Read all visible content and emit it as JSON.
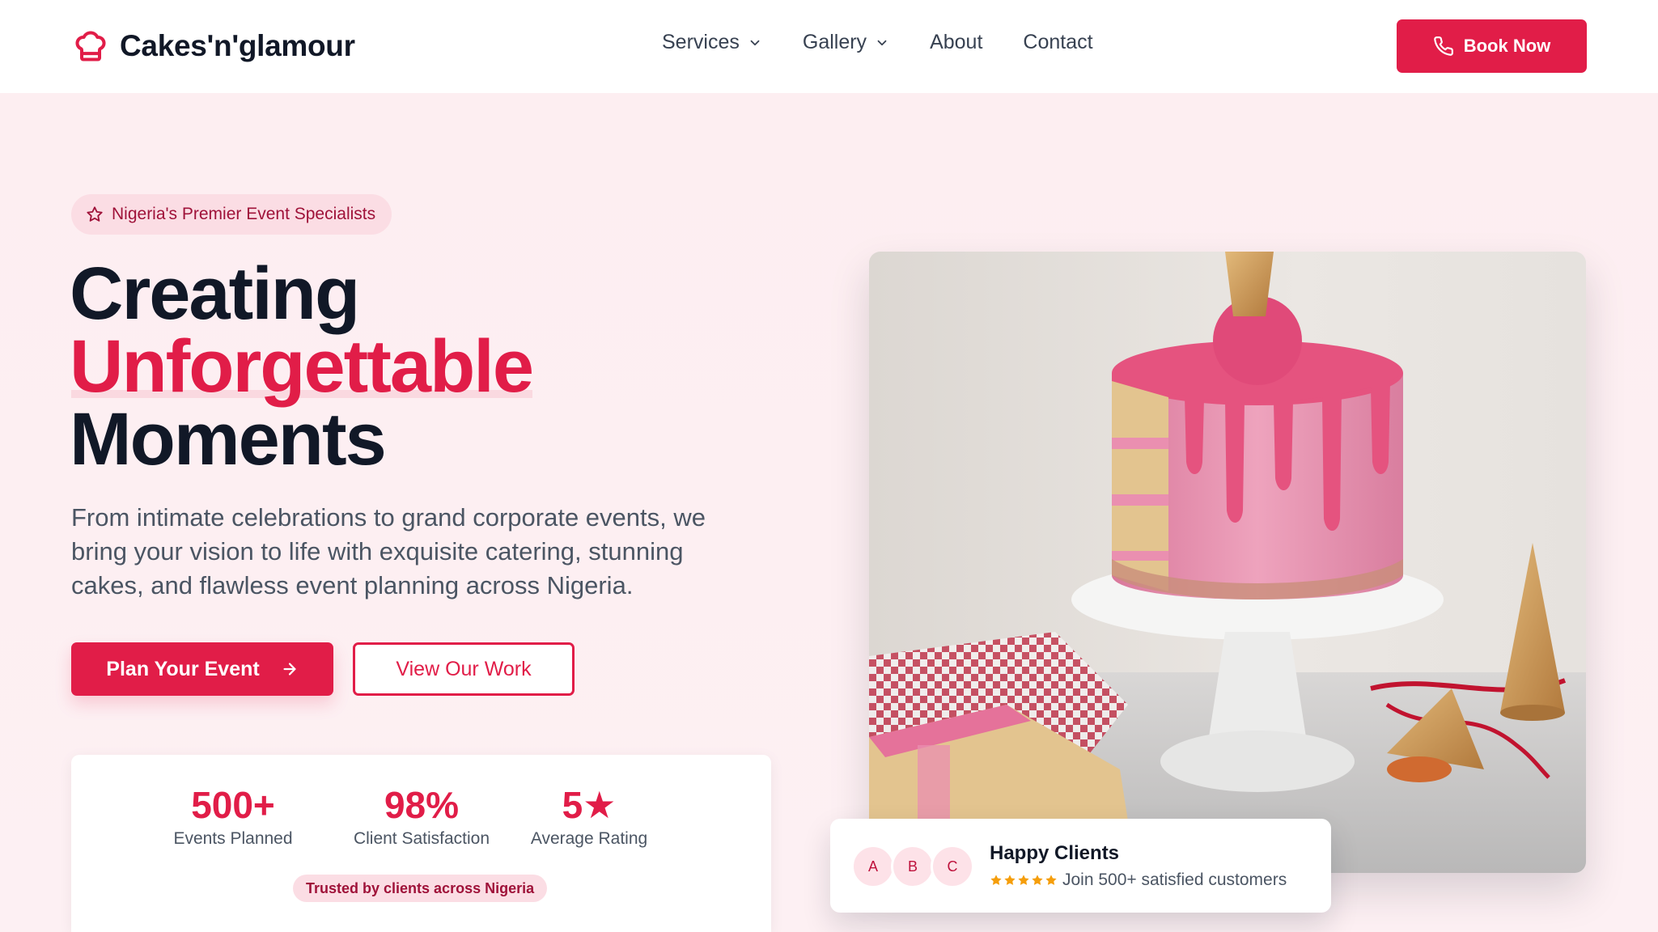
{
  "brand": {
    "name": "Cakes'n'glamour",
    "icon": "chef-hat-icon"
  },
  "nav": {
    "items": [
      {
        "label": "Services",
        "has_dropdown": true
      },
      {
        "label": "Gallery",
        "has_dropdown": true
      },
      {
        "label": "About",
        "has_dropdown": false
      },
      {
        "label": "Contact",
        "has_dropdown": false
      }
    ],
    "book_label": "Book Now"
  },
  "hero": {
    "badge": "Nigeria's Premier Event Specialists",
    "headline": {
      "line1": "Creating",
      "line2": "Unforgettable",
      "line3": "Moments"
    },
    "lead": "From intimate celebrations to grand corporate events, we bring your vision to life with exquisite catering, stunning cakes, and flawless event planning across Nigeria.",
    "primary_cta": "Plan Your Event",
    "secondary_cta": "View Our Work"
  },
  "stats": {
    "items": [
      {
        "value": "500+",
        "label": "Events Planned"
      },
      {
        "value": "98%",
        "label": "Client Satisfaction"
      },
      {
        "value": "5★",
        "label": "Average Rating"
      }
    ],
    "trust_badge": "Trusted by clients across Nigeria"
  },
  "clients_card": {
    "avatars": [
      "A",
      "B",
      "C"
    ],
    "title": "Happy Clients",
    "subtitle": "Join 500+ satisfied customers",
    "rating_stars": 5
  },
  "colors": {
    "accent": "#e11d48",
    "accent_dark": "#9f1239",
    "hero_bg": "#fdeef1",
    "text": "#111827",
    "muted": "#4b5563",
    "star": "#f59e0b"
  }
}
